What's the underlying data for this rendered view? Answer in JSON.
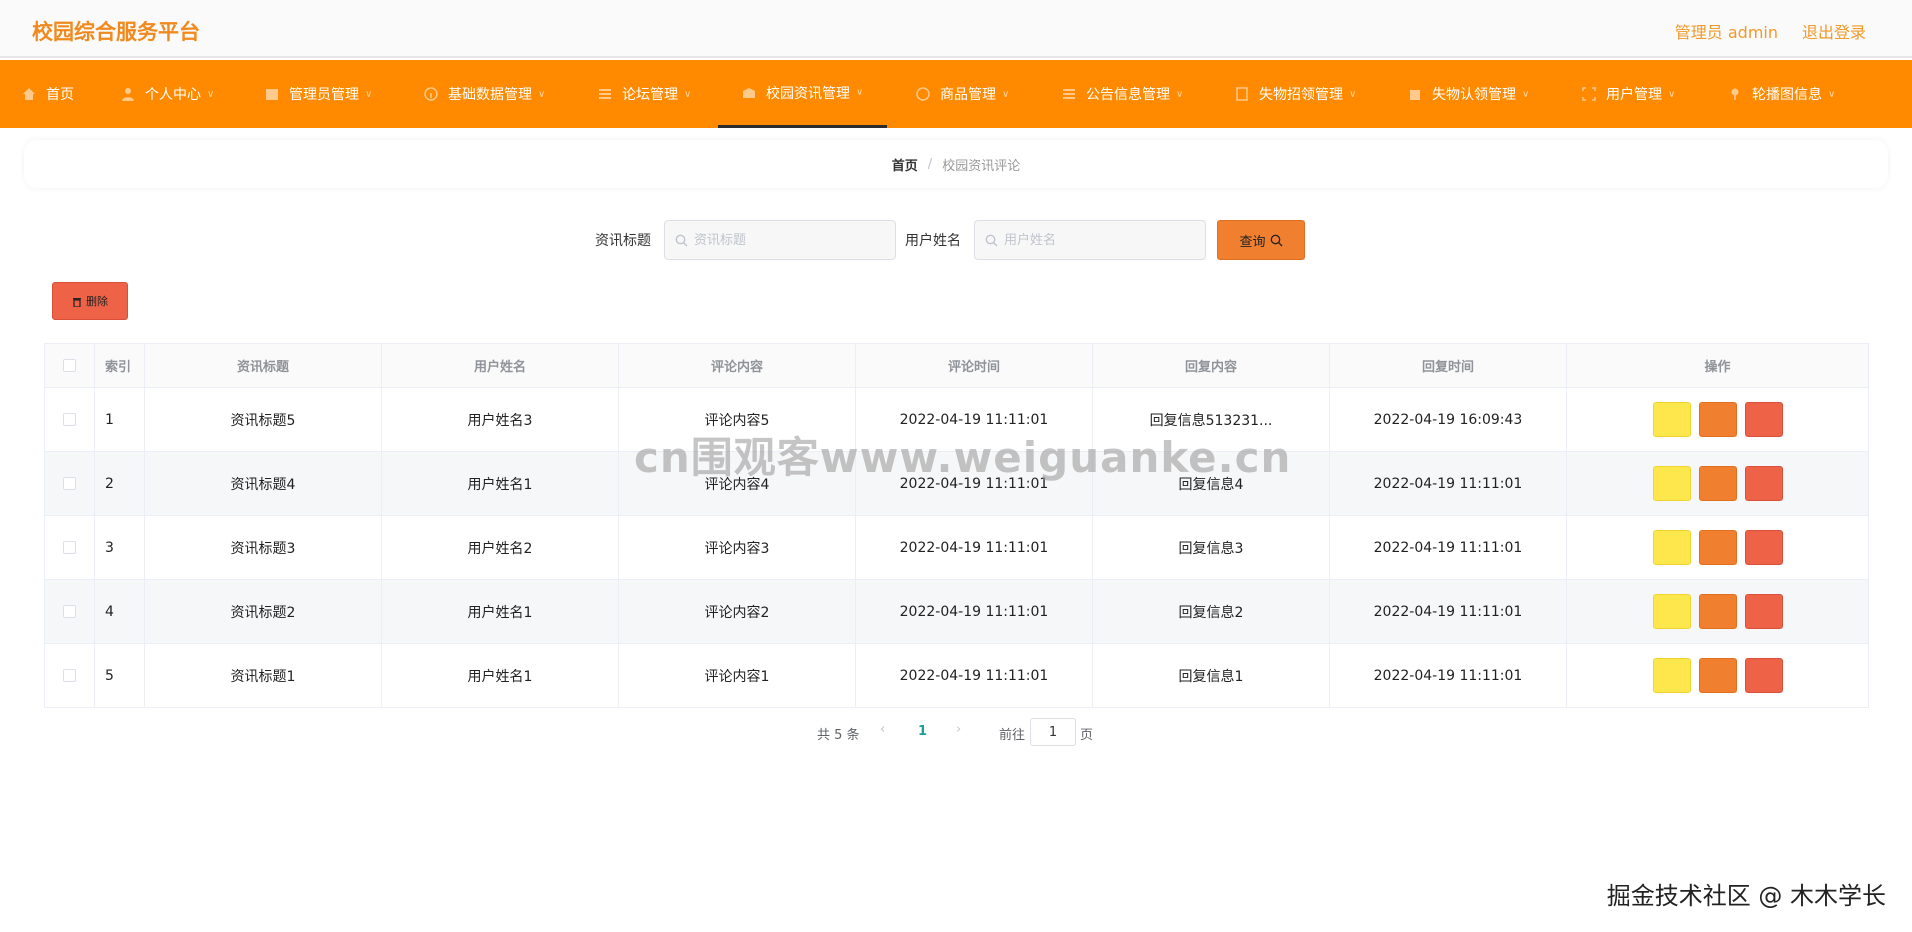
{
  "header": {
    "title": "校园综合服务平台",
    "admin_label": "管理员 admin",
    "logout": "退出登录"
  },
  "nav": {
    "items": [
      {
        "label": "首页",
        "icon": "home-icon"
      },
      {
        "label": "个人中心",
        "icon": "user-icon"
      },
      {
        "label": "管理员管理",
        "icon": "folder-icon"
      },
      {
        "label": "基础数据管理",
        "icon": "info-icon"
      },
      {
        "label": "论坛管理",
        "icon": "list-icon"
      },
      {
        "label": "校园资讯管理",
        "icon": "newspaper-icon"
      },
      {
        "label": "商品管理",
        "icon": "goods-icon"
      },
      {
        "label": "公告信息管理",
        "icon": "notice-icon"
      },
      {
        "label": "失物招领管理",
        "icon": "document-icon"
      },
      {
        "label": "失物认领管理",
        "icon": "bag-icon"
      },
      {
        "label": "用户管理",
        "icon": "users-icon"
      },
      {
        "label": "轮播图信息",
        "icon": "image-icon"
      }
    ],
    "active_index": 5
  },
  "breadcrumb": {
    "home": "首页",
    "separator": "/",
    "current": "校园资讯评论"
  },
  "search": {
    "title_label": "资讯标题",
    "title_placeholder": "资讯标题",
    "user_label": "用户姓名",
    "user_placeholder": "用户姓名",
    "query_button": "查询"
  },
  "toolbar": {
    "delete_button": "删除"
  },
  "table": {
    "columns": [
      "索引",
      "资讯标题",
      "用户姓名",
      "评论内容",
      "评论时间",
      "回复内容",
      "回复时间",
      "操作"
    ],
    "rows": [
      {
        "index": "1",
        "title": "资讯标题5",
        "user": "用户姓名3",
        "comment": "评论内容5",
        "comment_time": "2022-04-19 11:11:01",
        "reply": "回复信息513231...",
        "reply_time": "2022-04-19 16:09:43"
      },
      {
        "index": "2",
        "title": "资讯标题4",
        "user": "用户姓名1",
        "comment": "评论内容4",
        "comment_time": "2022-04-19 11:11:01",
        "reply": "回复信息4",
        "reply_time": "2022-04-19 11:11:01"
      },
      {
        "index": "3",
        "title": "资讯标题3",
        "user": "用户姓名2",
        "comment": "评论内容3",
        "comment_time": "2022-04-19 11:11:01",
        "reply": "回复信息3",
        "reply_time": "2022-04-19 11:11:01"
      },
      {
        "index": "4",
        "title": "资讯标题2",
        "user": "用户姓名1",
        "comment": "评论内容2",
        "comment_time": "2022-04-19 11:11:01",
        "reply": "回复信息2",
        "reply_time": "2022-04-19 11:11:01"
      },
      {
        "index": "5",
        "title": "资讯标题1",
        "user": "用户姓名1",
        "comment": "评论内容1",
        "comment_time": "2022-04-19 11:11:01",
        "reply": "回复信息1",
        "reply_time": "2022-04-19 11:11:01"
      }
    ]
  },
  "pagination": {
    "total": "共 5 条",
    "current_page": "1",
    "goto_label": "前往",
    "goto_value": "1",
    "goto_unit": "页"
  },
  "watermarks": {
    "center": "cn围观客www.weiguanke.cn",
    "corner": "掘金技术社区 @ 木木学长"
  },
  "colors": {
    "accent": "#ff8a00",
    "title": "#f08a1e",
    "op_yellow": "#fde74c",
    "op_orange": "#f08030",
    "op_red": "#ee6247"
  }
}
